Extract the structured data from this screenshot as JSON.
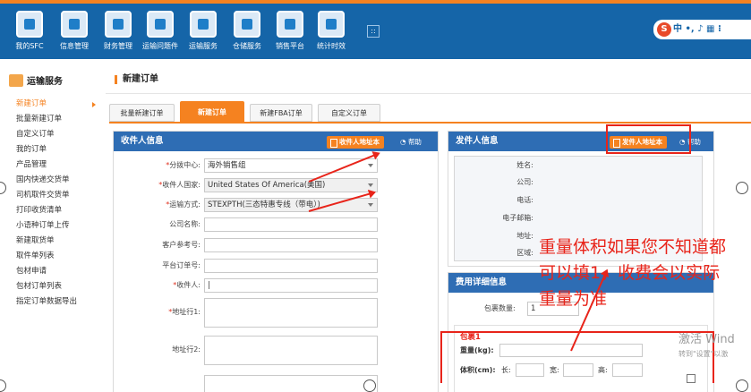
{
  "nav": {
    "items": [
      {
        "label": "我的SFC",
        "icon": "home-icon"
      },
      {
        "label": "信息管理",
        "icon": "gears-icon"
      },
      {
        "label": "财务管理",
        "icon": "credit-card-icon"
      },
      {
        "label": "运输问题件",
        "icon": "envelope-icon"
      },
      {
        "label": "运输服务",
        "icon": "cart-icon"
      },
      {
        "label": "仓储服务",
        "icon": "warehouse-icon"
      },
      {
        "label": "销售平台",
        "icon": "monitor-icon"
      },
      {
        "label": "统计时效",
        "icon": "clock-icon"
      }
    ],
    "collapse": "::",
    "ime": "中 •, ♪ ▦ ⁝"
  },
  "sidebar": {
    "title": "运输服务",
    "items": [
      "新建订单",
      "批量新建订单",
      "自定义订单",
      "我的订单",
      "产品管理",
      "国内快递交货单",
      "司机取件交货单",
      "打印收货清单",
      "小语种订单上传",
      "新建取货单",
      "取件单列表",
      "包材申请",
      "包材订单列表",
      "指定订单数据导出"
    ]
  },
  "page": {
    "title": "新建订单",
    "tabs": [
      "批量新建订单",
      "新建订单",
      "新建FBA订单",
      "自定义订单"
    ]
  },
  "receiver": {
    "title": "收件人信息",
    "address_book": "收件人地址本",
    "help": "帮助",
    "fields": {
      "branch_label": "分拨中心:",
      "branch_value": "海外销售组",
      "country_label": "收件人国家:",
      "country_value": "United States Of America(美国)",
      "method_label": "运输方式:",
      "method_value": "STEXPTH(三态特惠专线（带电）)",
      "company_label": "公司名称:",
      "ref_label": "客户参考号:",
      "platform_label": "平台订单号:",
      "name_label": "收件人:",
      "addr1_label": "地址行1:",
      "addr2_label": "地址行2:"
    }
  },
  "sender": {
    "title": "发件人信息",
    "address_book": "发件人地址本",
    "help": "帮助",
    "labels": [
      "姓名:",
      "公司:",
      "电话:",
      "电子邮箱:",
      "地址:",
      "区域:"
    ]
  },
  "fees": {
    "title": "费用详细信息",
    "pkg_count_label": "包裹数量:",
    "pkg_count_value": "1",
    "pkg_title": "包裹1",
    "weight_label": "重量(kg):",
    "volume_label": "体积(cm):",
    "length_label": "长:",
    "width_label": "宽:",
    "height_label": "高:"
  },
  "annotation": "重量体积如果您不知道都可以填1，收费会以实际重量为准",
  "watermark": {
    "line1": "激活 Wind",
    "line2": "转到\"设置\"以激"
  },
  "colors": {
    "accent": "#f58220",
    "nav": "#1565a8",
    "panel_head": "#2e6db4",
    "markup": "#e8241a"
  }
}
